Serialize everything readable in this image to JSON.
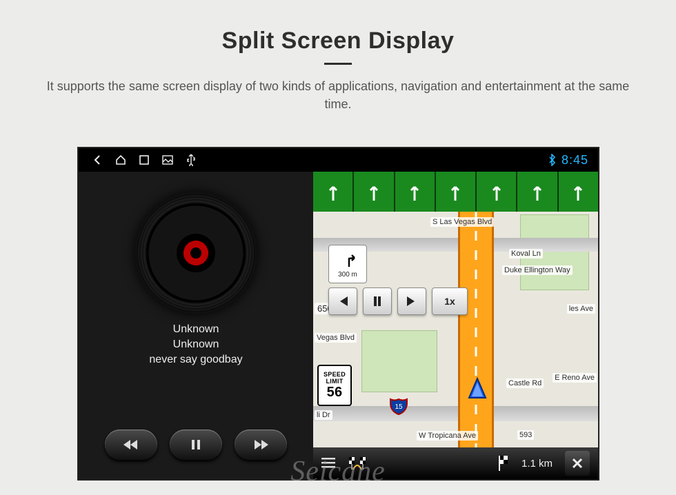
{
  "page": {
    "title": "Split Screen Display",
    "subtitle": "It supports the same screen display of two kinds of applications, navigation and entertainment at the same time."
  },
  "statusbar": {
    "clock": "8:45",
    "icons": [
      "back",
      "home",
      "recent",
      "gallery",
      "usb"
    ]
  },
  "media": {
    "line1": "Unknown",
    "line2": "Unknown",
    "line3": "never say goodbay"
  },
  "nav": {
    "lane_arrows": 7,
    "turn": {
      "distance": "300 m"
    },
    "approach_distance": "650 m",
    "speed_limit": {
      "top": "SPEED",
      "mid": "LIMIT",
      "value": "56"
    },
    "controls": {
      "speed_label": "1x"
    },
    "streets": {
      "top": "S Las Vegas Blvd",
      "koval": "Koval Ln",
      "ellington": "Duke Ellington Way",
      "miles": "les Ave",
      "vegas_blvd2": "Vegas Blvd",
      "castle": "Castle Rd",
      "reno": "E Reno Ave",
      "ali": "li Dr",
      "tropicana": "W Tropicana Ave",
      "tropicana_no": "593"
    },
    "bottombar": {
      "eta_distance": "1.1 km"
    }
  },
  "watermark": "Seicane"
}
